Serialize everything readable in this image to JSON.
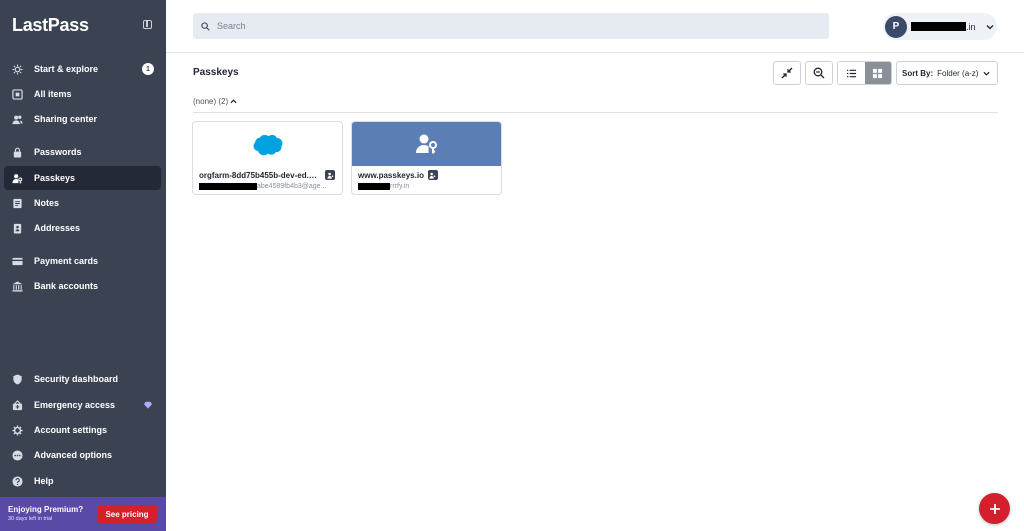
{
  "app": {
    "name": "LastPass"
  },
  "sidebar": {
    "items": [
      {
        "label": "Start & explore",
        "icon": "lightbulb-icon",
        "badge": "1"
      },
      {
        "label": "All items",
        "icon": "grid-icon"
      },
      {
        "label": "Sharing center",
        "icon": "users-icon"
      },
      {
        "label": "Passwords",
        "icon": "lock-icon"
      },
      {
        "label": "Passkeys",
        "icon": "passkey-icon",
        "active": true
      },
      {
        "label": "Notes",
        "icon": "note-icon"
      },
      {
        "label": "Addresses",
        "icon": "address-icon"
      },
      {
        "label": "Payment cards",
        "icon": "card-icon"
      },
      {
        "label": "Bank accounts",
        "icon": "bank-icon"
      },
      {
        "label": "Security dashboard",
        "icon": "shield-icon"
      },
      {
        "label": "Emergency access",
        "icon": "lifebuoy-icon",
        "premium": true
      },
      {
        "label": "Account settings",
        "icon": "gear-icon"
      },
      {
        "label": "Advanced options",
        "icon": "dots-icon"
      },
      {
        "label": "Help",
        "icon": "help-icon"
      }
    ],
    "promo": {
      "title": "Enjoying Premium?",
      "subtitle": "30 days left in trial",
      "button": "See pricing"
    }
  },
  "header": {
    "search_placeholder": "Search",
    "user": {
      "initial": "P",
      "email_suffix": ".in"
    }
  },
  "main": {
    "title": "Passkeys",
    "sort_label": "Sort By:",
    "sort_value": "Folder (a-z)",
    "folder": "(none) (2)",
    "cards": [
      {
        "title": "orgfarm-8dd75b455b-dev-ed.de...",
        "subtitle": "abe4589fb4b3@age...",
        "logo": "salesforce",
        "logo_text": "salesforce"
      },
      {
        "title": "www.passkeys.io",
        "subtitle": "rrrfy.in",
        "logo": "passkey"
      }
    ]
  },
  "colors": {
    "sidebar": "#3b4353",
    "accent_red": "#d4202c",
    "card_blue": "#5b7fb5",
    "salesforce": "#00a1e0"
  }
}
